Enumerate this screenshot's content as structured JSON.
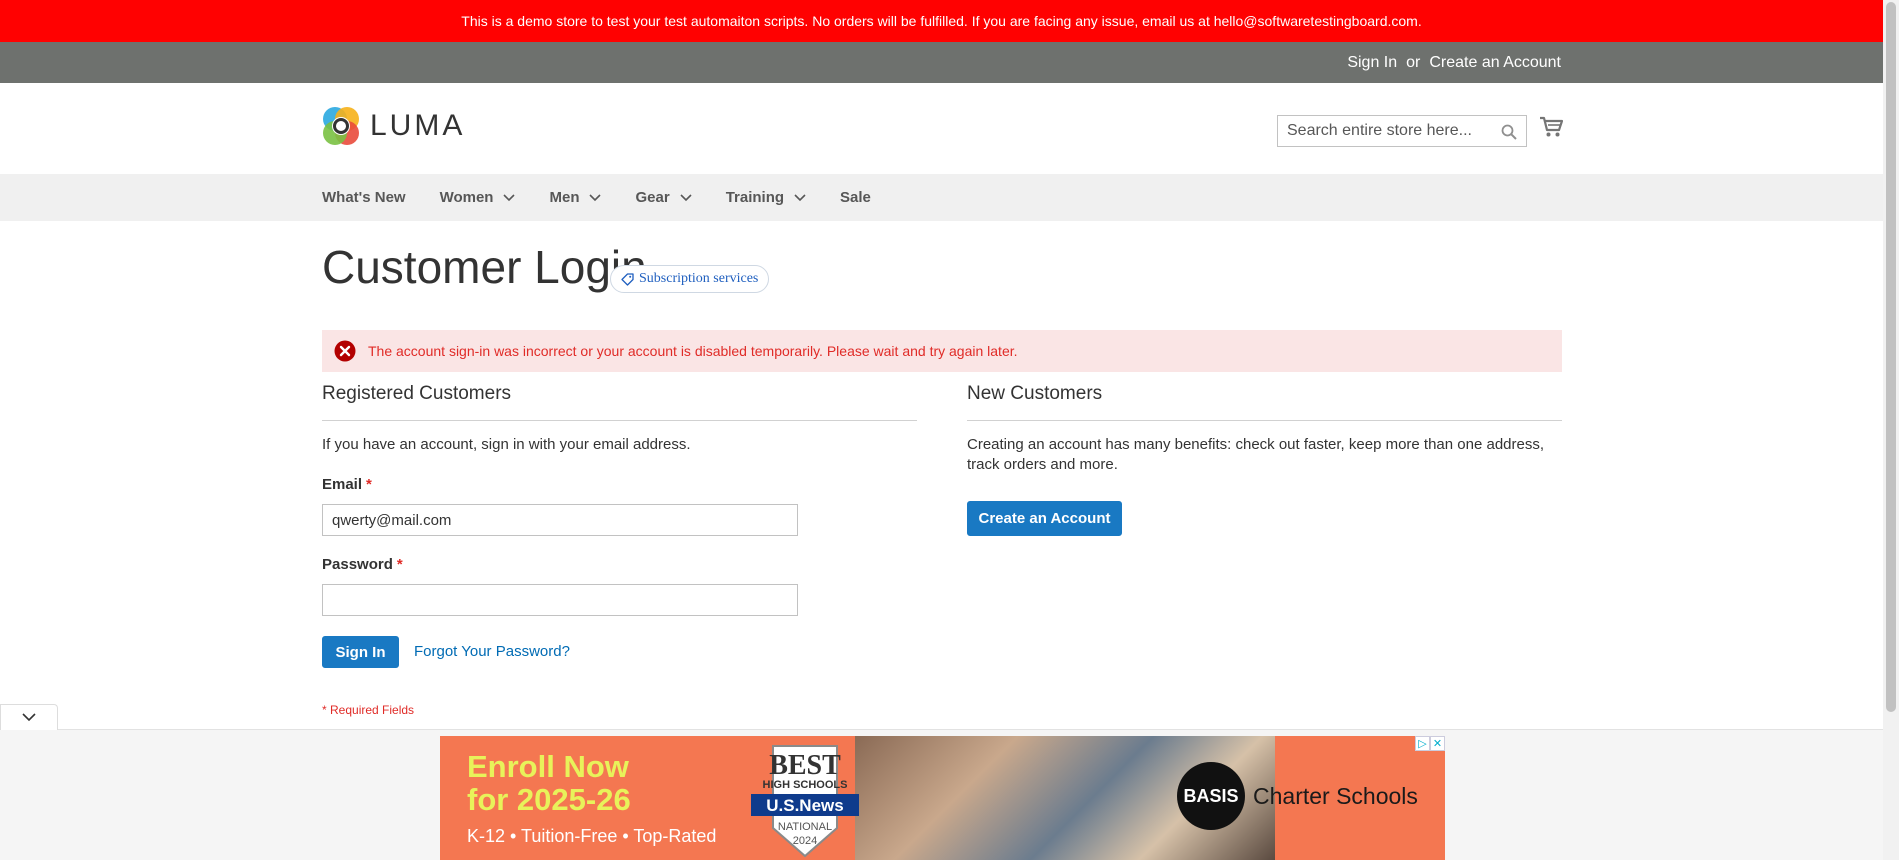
{
  "demo_notice": "This is a demo store to test your test automaiton scripts. No orders will be fulfilled. If you are facing any issue, email us at hello@softwaretestingboard.com.",
  "panel": {
    "sign_in": "Sign In",
    "or": "or",
    "create_account": "Create an Account"
  },
  "header": {
    "logo_text": "LUMA",
    "search_placeholder": "Search entire store here..."
  },
  "nav": [
    {
      "label": "What's New",
      "dropdown": false
    },
    {
      "label": "Women",
      "dropdown": true
    },
    {
      "label": "Men",
      "dropdown": true
    },
    {
      "label": "Gear",
      "dropdown": true
    },
    {
      "label": "Training",
      "dropdown": true
    },
    {
      "label": "Sale",
      "dropdown": false
    }
  ],
  "page": {
    "title": "Customer Login",
    "subscription_badge": "Subscription services",
    "error": "The account sign-in was incorrect or your account is disabled temporarily. Please wait and try again later."
  },
  "registered": {
    "title": "Registered Customers",
    "intro": "If you have an account, sign in with your email address.",
    "email_label": "Email",
    "email_value": "qwerty@mail.com",
    "password_label": "Password",
    "password_value": "",
    "required_mark": "*",
    "sign_in_button": "Sign In",
    "forgot_link": "Forgot Your Password?",
    "required_note": "* Required Fields"
  },
  "new_customers": {
    "title": "New Customers",
    "intro": "Creating an account has many benefits: check out faster, keep more than one address, track orders and more.",
    "create_button": "Create an Account"
  },
  "ad": {
    "headline_1": "Enroll Now",
    "headline_2": "for 2025-26",
    "subline": "K-12 • Tuition-Free • Top-Rated",
    "badge_1": "BEST",
    "badge_2": "HIGH SCHOOLS",
    "badge_3": "U.S.News",
    "badge_4": "NATIONAL",
    "badge_5": "2024",
    "logo_mark": "BASIS",
    "logo_text": "Charter Schools"
  },
  "colors": {
    "demo_bar": "#ff0101",
    "panel": "#6e716e",
    "primary": "#1979c3",
    "error_text": "#e02b27",
    "error_bg": "#fae5e5"
  }
}
